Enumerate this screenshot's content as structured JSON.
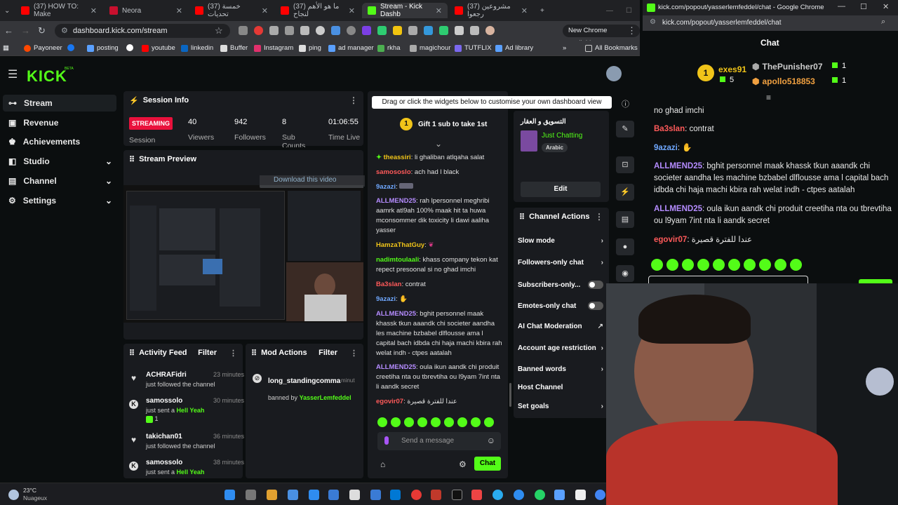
{
  "browser": {
    "tabs": [
      {
        "label": "(37) HOW TO: Make",
        "color": "#ff0000"
      },
      {
        "label": "Neora",
        "color": "#c8102e"
      },
      {
        "label": "(37) خمسة تحديات",
        "color": "#ff0000"
      },
      {
        "label": "(37) ما هو الأهم لنجاح",
        "color": "#ff0000"
      },
      {
        "label": "Stream - Kick Dashb",
        "color": "#53fc18"
      },
      {
        "label": "(37) مشروعين رجعوا",
        "color": "#ff0000"
      }
    ],
    "url": "dashboard.kick.com/stream",
    "new_chrome": "New Chrome available",
    "bookmarks": [
      "Payoneer",
      "posting",
      "youtube",
      "linkedin",
      "Buffer",
      "Instagram",
      "ping",
      "ad manager",
      "rkha",
      "magichour",
      "TUTFLIX",
      "Ad library"
    ],
    "all_bookmarks": "All Bookmarks"
  },
  "dashboard": {
    "logo": "KICK",
    "beta": "BETA",
    "sidebar": [
      {
        "label": "Stream",
        "icon": "stream-icon"
      },
      {
        "label": "Revenue",
        "icon": "dollar-icon"
      },
      {
        "label": "Achievements",
        "icon": "trophy-icon"
      },
      {
        "label": "Studio",
        "icon": "studio-icon"
      },
      {
        "label": "Channel",
        "icon": "channel-icon"
      },
      {
        "label": "Settings",
        "icon": "gear-icon"
      }
    ],
    "session": {
      "title": "Session Info",
      "badge": "STREAMING",
      "badge_sub": "Session",
      "stats": [
        {
          "value": "40",
          "label": "Viewers"
        },
        {
          "value": "942",
          "label": "Followers"
        },
        {
          "value": "8",
          "label": "Sub Counts"
        },
        {
          "value": "01:06:55",
          "label": "Time Live"
        }
      ]
    },
    "preview": {
      "title": "Stream Preview",
      "download": "Download this video"
    },
    "tooltip": "Drag or click the widgets below to customise your own dashboard view",
    "gift": "Gift 1 sub to take 1st",
    "gift_rank": "1",
    "chat": [
      {
        "user": "theassiri",
        "color": "#f0c419",
        "text": "li ghaliban atlqaha salat"
      },
      {
        "user": "samososlo",
        "color": "#ff5a5a",
        "text": "ach had l black"
      },
      {
        "user": "9azazi",
        "color": "#6fa8ff",
        "text": ""
      },
      {
        "user": "ALLMEND25",
        "color": "#b58cff",
        "text": "rah lpersonnel meghribi aamrk atl9ah 100% maak hit ta huwa mconsommer dik toxicity li dawi aaliha yasser"
      },
      {
        "user": "HamzaThatGuy",
        "color": "#f0c419",
        "text": ""
      },
      {
        "user": "nadimtoulaali",
        "color": "#53fc18",
        "text": "khass company tekon kat repect presoonal si no ghad imchi"
      },
      {
        "user": "Ba3slan",
        "color": "#ff5a5a",
        "text": "contrat"
      },
      {
        "user": "9azazi",
        "color": "#6fa8ff",
        "text": ""
      },
      {
        "user": "ALLMEND25",
        "color": "#b58cff",
        "text": "bghit personnel maak khassk tkun aaandk chi societer aandha les machine bzbabel dlflousse ama l capital bach idbda chi haja machi kbira rah welat indh - ctpes aatalah"
      },
      {
        "user": "ALLMEND25",
        "color": "#b58cff",
        "text": "oula ikun aandk chi produit creetiha nta ou tbrevtiha ou l9yam 7int nta li aandk secret"
      },
      {
        "user": "egovir07",
        "color": "#ff5a5a",
        "text": "عندا للفترة قصيرة"
      }
    ],
    "send_placeholder": "Send a message",
    "chat_button": "Chat",
    "stream_meta": {
      "title": "التسويق و العقار",
      "category": "Just Chatting",
      "tag": "Arabic",
      "edit": "Edit"
    },
    "actions": {
      "title": "Channel Actions",
      "items": [
        {
          "label": "Slow mode",
          "kind": "chevron"
        },
        {
          "label": "Followers-only chat",
          "kind": "chevron"
        },
        {
          "label": "Subscribers-only...",
          "kind": "toggle"
        },
        {
          "label": "Emotes-only chat",
          "kind": "toggle"
        },
        {
          "label": "AI Chat Moderation",
          "kind": "external"
        },
        {
          "label": "Account age restriction",
          "kind": "chevron"
        },
        {
          "label": "Banned words",
          "kind": "chevron"
        },
        {
          "label": "Host Channel",
          "kind": "none"
        },
        {
          "label": "Set goals",
          "kind": "chevron"
        }
      ]
    },
    "activity": {
      "title": "Activity Feed",
      "filter": "Filter",
      "items": [
        {
          "user": "ACHRAFidri",
          "time": "23 minutes ago",
          "text": "just followed the channel",
          "icon": "heart-icon",
          "extra": ""
        },
        {
          "user": "samossolo",
          "time": "30 minutes ago",
          "text": "just sent a",
          "highlight": "Hell Yeah",
          "icon": "kick-icon",
          "extra": "1"
        },
        {
          "user": "takichan01",
          "time": "36 minutes ago",
          "text": "just followed the channel",
          "icon": "heart-icon",
          "extra": ""
        },
        {
          "user": "samossolo",
          "time": "38 minutes ago",
          "text": "just sent a",
          "highlight": "Hell Yeah",
          "icon": "kick-icon",
          "extra": ""
        }
      ]
    },
    "mod": {
      "title": "Mod Actions",
      "filter": "Filter",
      "user": "long_standingcommar",
      "time": "minut",
      "by_text": "banned by",
      "by_user": "YasserLemfeddel"
    }
  },
  "popout": {
    "title_url": "kick.com/popout/yasserlemfeddel/chat - Google Chrome",
    "url": "kick.com/popout/yasserlemfeddel/chat",
    "header": "Chat",
    "leaders": [
      {
        "rank": "1",
        "name": "exes91",
        "sub": "5"
      },
      {
        "name": "ThePunisher07",
        "sub": "1"
      },
      {
        "name": "apollo518853",
        "sub": "1"
      }
    ],
    "messages": [
      {
        "user": "",
        "color": "#e8e8e8",
        "text": "no ghad imchi"
      },
      {
        "user": "Ba3slan",
        "color": "#ff5a5a",
        "text": "contrat"
      },
      {
        "user": "9azazi",
        "color": "#6fa8ff",
        "text": ""
      },
      {
        "user": "ALLMEND25",
        "color": "#b58cff",
        "text": "bghit personnel maak khassk tkun aaandk chi societer aandha les machine bzbabel dlflousse ama l capital bach idbda chi haja machi kbira rah welat indh - ctpes aatalah"
      },
      {
        "user": "ALLMEND25",
        "color": "#b58cff",
        "text": "oula ikun aandk chi produit creetiha nta ou tbrevtiha ou l9yam 7int nta li aandk secret"
      },
      {
        "user": "egovir07",
        "color": "#ff5a5a",
        "text": "عندا للفترة قصيرة"
      }
    ]
  },
  "taskbar": {
    "temp": "23°C",
    "weather": "Nuageux"
  }
}
